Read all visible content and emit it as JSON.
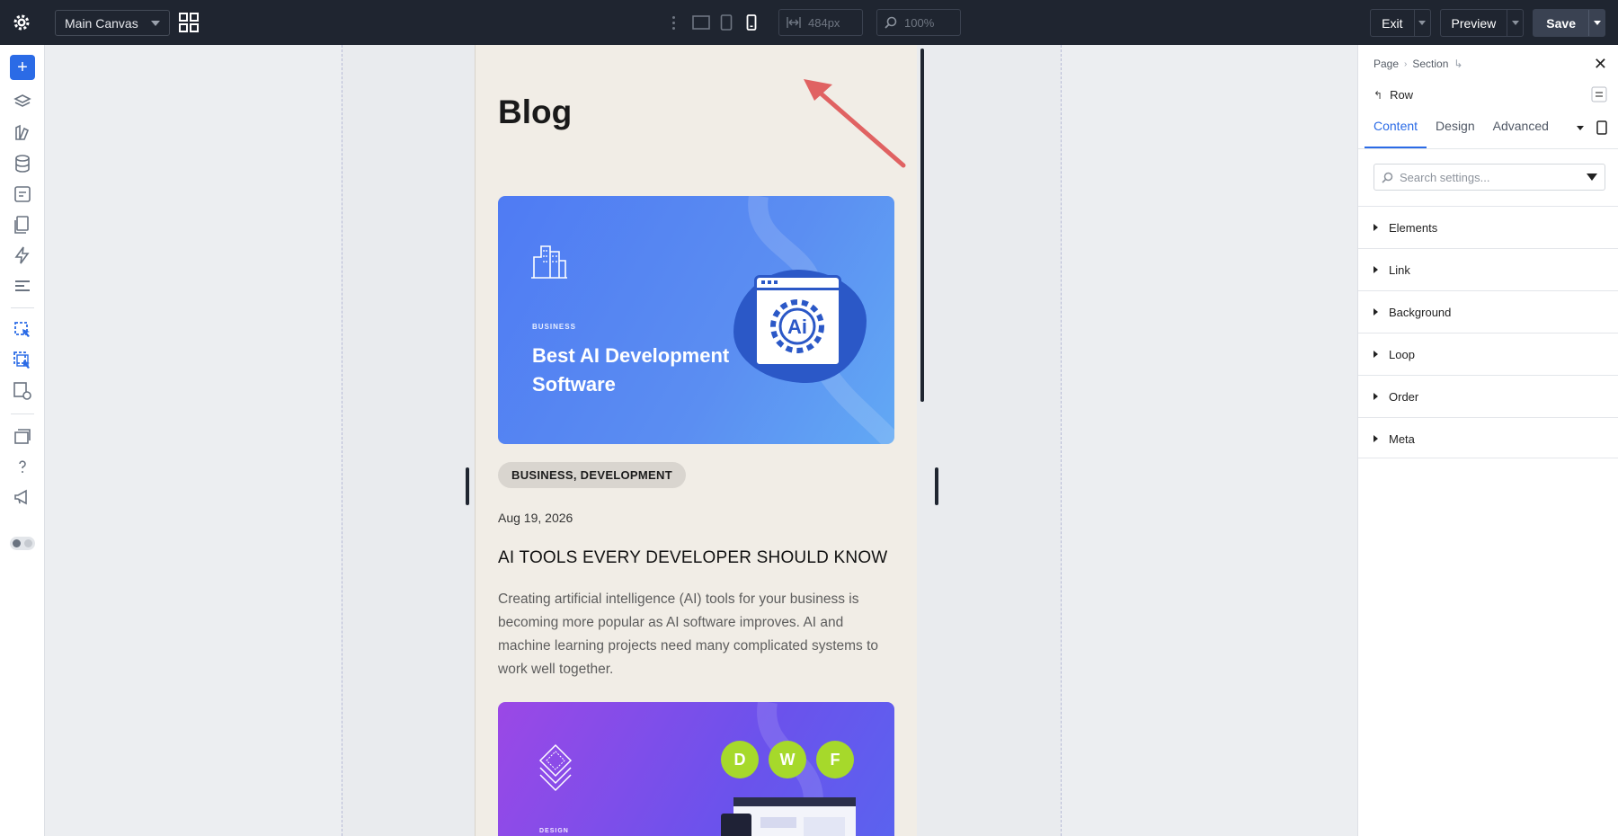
{
  "topbar": {
    "canvas_select": "Main Canvas",
    "width_value": "484px",
    "zoom_value": "100%",
    "exit_label": "Exit",
    "preview_label": "Preview",
    "save_label": "Save"
  },
  "canvas": {
    "blog_title": "Blog",
    "post1": {
      "image_category": "BUSINESS",
      "image_title": "Best AI Development Software",
      "image_icon_text": "Ai",
      "tag": "BUSINESS, DEVELOPMENT",
      "date": "Aug 19, 2026",
      "title": "AI TOOLS EVERY DEVELOPER SHOULD KNOW",
      "excerpt": "Creating artificial intelligence (AI) tools for your business is becoming more popular as AI software improves. AI and machine learning projects need many complicated systems to work well together."
    },
    "post2": {
      "image_category": "DESIGN",
      "badges": [
        "D",
        "W",
        "F"
      ]
    }
  },
  "panel": {
    "breadcrumb": [
      "Page",
      "Section"
    ],
    "element": "Row",
    "tabs": [
      "Content",
      "Design",
      "Advanced"
    ],
    "active_tab": "Content",
    "search_placeholder": "Search settings...",
    "groups": [
      "Elements",
      "Link",
      "Background",
      "Loop",
      "Order",
      "Meta"
    ]
  },
  "colors": {
    "accent": "#2b6be6",
    "topbar": "#1f2530",
    "annotation_arrow": "#e06262"
  }
}
